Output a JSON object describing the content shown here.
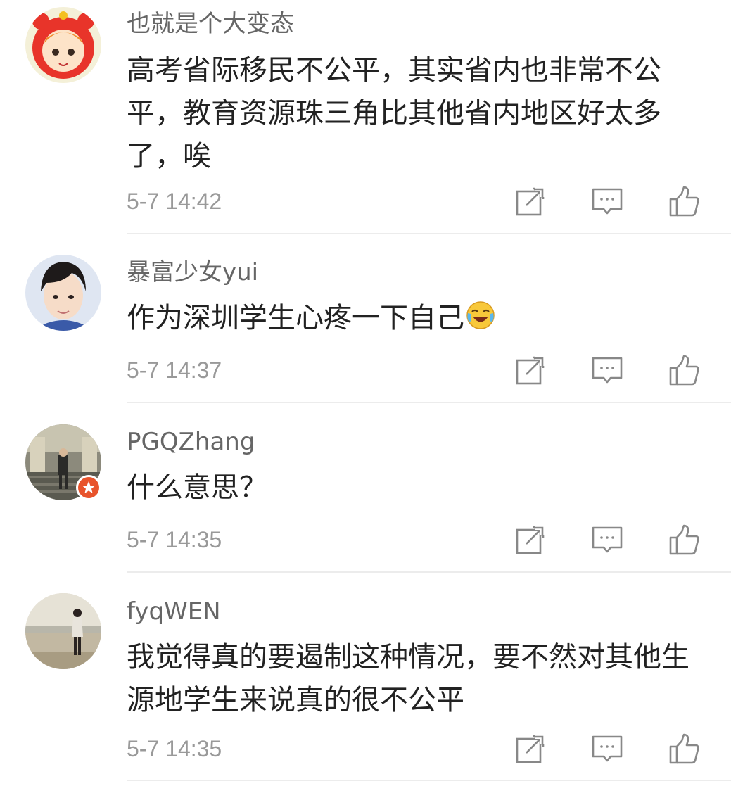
{
  "comments": [
    {
      "user": "也就是个大变态",
      "text": "高考省际移民不公平，其实省内也非常不公平，教育资源珠三角比其他省内地区好太多了，唉",
      "time": "5-7 14:42"
    },
    {
      "user": "暴富少女yui",
      "text": "作为深圳学生心疼一下自己",
      "emoji": "laughing-crying-emoji",
      "time": "5-7 14:37"
    },
    {
      "user": "PGQZhang",
      "text": "什么意思？",
      "badge": "verified-badge",
      "time": "5-7 14:35"
    },
    {
      "user": "fyqWEN",
      "text": "我觉得真的要遏制这种情况，要不然对其他生源地学生来说真的很不公平",
      "time": "5-7 14:35"
    }
  ],
  "actions": [
    "share-icon",
    "reply-icon",
    "like-icon"
  ],
  "colors": {
    "username": "#666666",
    "text": "#222222",
    "time": "#999999",
    "icon": "#888888",
    "divider": "#ececec",
    "badge": "#e8542c"
  }
}
